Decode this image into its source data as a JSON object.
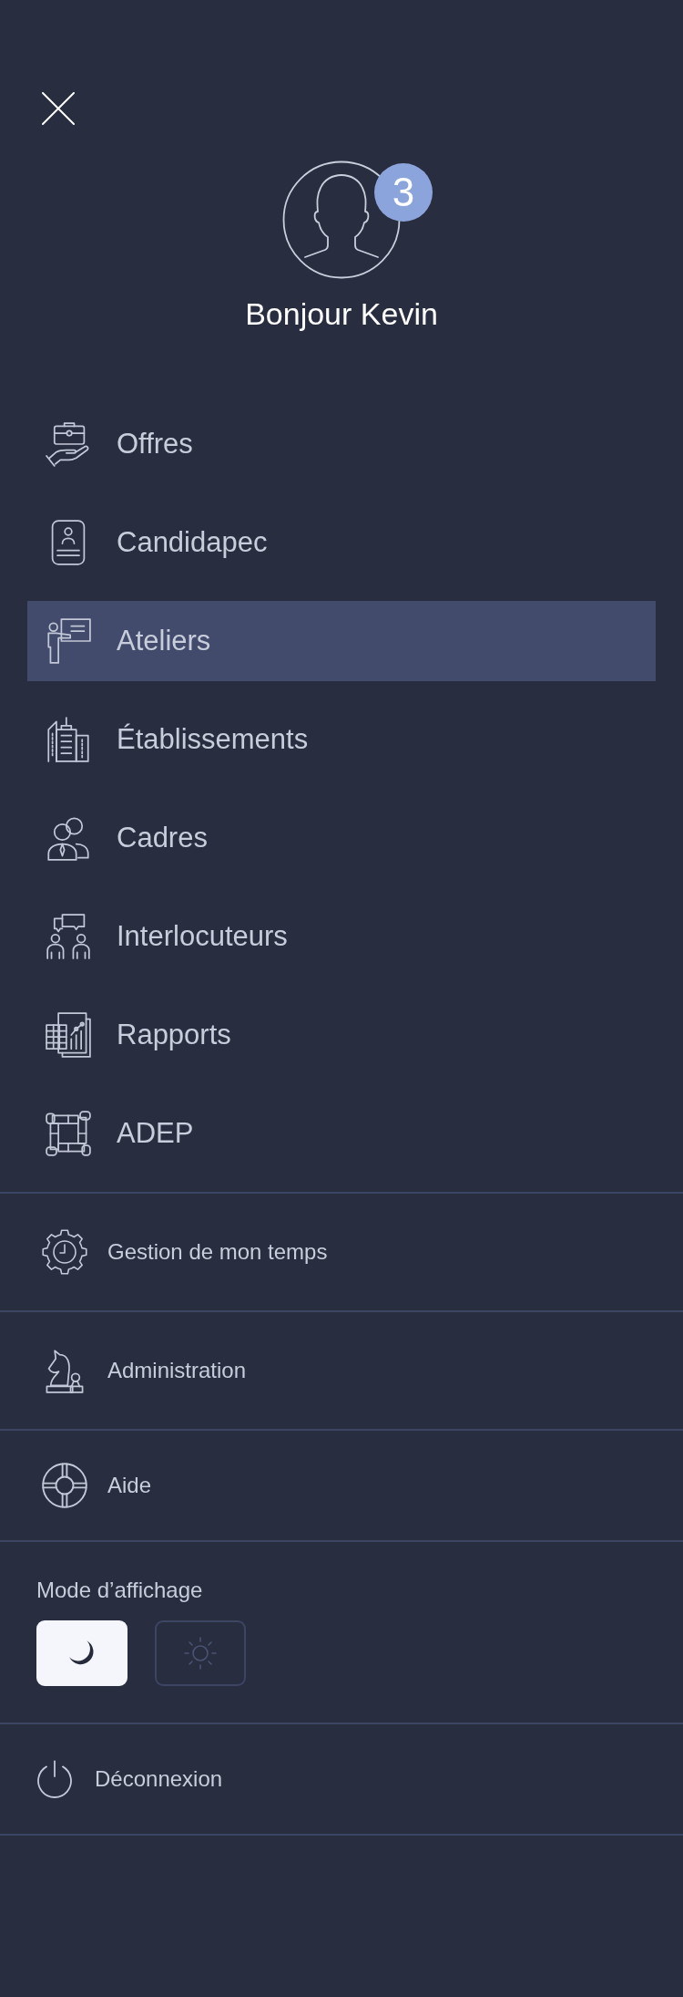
{
  "profile": {
    "badge": "3",
    "greeting": "Bonjour Kevin"
  },
  "main_menu": [
    {
      "label": "Offres",
      "selected": false
    },
    {
      "label": "Candidapec",
      "selected": false
    },
    {
      "label": "Ateliers",
      "selected": true
    },
    {
      "label": "Établissements",
      "selected": false
    },
    {
      "label": "Cadres",
      "selected": false
    },
    {
      "label": "Interlocuteurs",
      "selected": false
    },
    {
      "label": "Rapports",
      "selected": false
    },
    {
      "label": "ADEP",
      "selected": false
    }
  ],
  "secondary_menu": [
    {
      "label": "Gestion de mon temps"
    },
    {
      "label": "Administration"
    },
    {
      "label": "Aide"
    }
  ],
  "display_mode": {
    "label": "Mode d’affichage",
    "options": [
      {
        "kind": "dark",
        "selected": true
      },
      {
        "kind": "light",
        "selected": false
      }
    ]
  },
  "logout": {
    "label": "Déconnexion"
  }
}
